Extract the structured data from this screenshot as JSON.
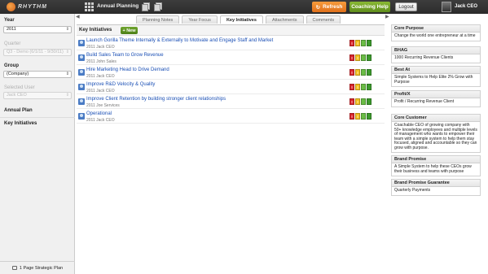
{
  "app": {
    "logo_text": "RHYTHM",
    "title": "Annual Planning",
    "refresh_label": "Refresh",
    "coaching_label": "Coaching Help",
    "logout_label": "Logout",
    "user_name": "Jack CEO"
  },
  "sidebar": {
    "year_label": "Year",
    "year_value": "2011",
    "quarter_label": "Quarter",
    "quarter_value": "Q3 - Demo (6/1/11 - 9/30/11)",
    "group_label": "Group",
    "group_value": "(Company)",
    "selected_user_label": "Selected User",
    "selected_user_value": "Jack CEO",
    "nav": [
      "Annual Plan",
      "Key Initiatives"
    ],
    "footer_label": "1 Page Strategic Plan"
  },
  "tabs": [
    {
      "label": "Planning Notes",
      "active": false
    },
    {
      "label": "Year Focus",
      "active": false
    },
    {
      "label": "Key Initiatives",
      "active": true
    },
    {
      "label": "Attachments",
      "active": false
    },
    {
      "label": "Comments",
      "active": false
    }
  ],
  "main": {
    "title": "Key Initiatives",
    "new_label": "+ New",
    "initiatives": [
      {
        "title": "Launch Gorilla Theme Internally & Externally to Motivate and Engage Staff and Market",
        "sub": "2011 Jack CEO"
      },
      {
        "title": "Build Sales Team to Grow Revenue",
        "sub": "2011 John Sales"
      },
      {
        "title": "Hire Marketing Head to Drive Demand",
        "sub": "2011 Jack CEO"
      },
      {
        "title": "Improve R&D Velocity & Quality",
        "sub": "2011 Jack CEO"
      },
      {
        "title": "Improve Client Retention by building stronger client relationships",
        "sub": "2011 Joe Services"
      },
      {
        "title": "Operational",
        "sub": "2011 Jack CEO"
      }
    ],
    "status_colors": [
      "#d9262b",
      "#f4c21f",
      "#6abd45",
      "#3c9a2c"
    ],
    "status_markers": [
      "!",
      "!",
      "",
      ""
    ]
  },
  "right": {
    "cards": [
      {
        "head": "Core Purpose",
        "body": "Change the world one entrepreneur at a time"
      },
      {
        "head": "BHAG",
        "body": "1000 Recurring Revenue Clients"
      },
      {
        "head": "Best At",
        "body": "Simple Systems to Help Elite 2% Grow with Purpose"
      },
      {
        "head": "Profit/X",
        "body": "Profit / Recurring Revenue Client"
      },
      {
        "head": "Core Customer",
        "body": "Coachable CEO of growing company with 50+ knowledge employees and multiple levels of management who wants to empower their team with a simple system to help them stay focused, aligned and accountable so they can grow with purpose."
      },
      {
        "head": "Brand Promise",
        "body": "A Simple System to help these CEOs grow their business and teams with purpose"
      },
      {
        "head": "Brand Promise Guarantee",
        "body": "Quarterly Payments"
      }
    ]
  }
}
